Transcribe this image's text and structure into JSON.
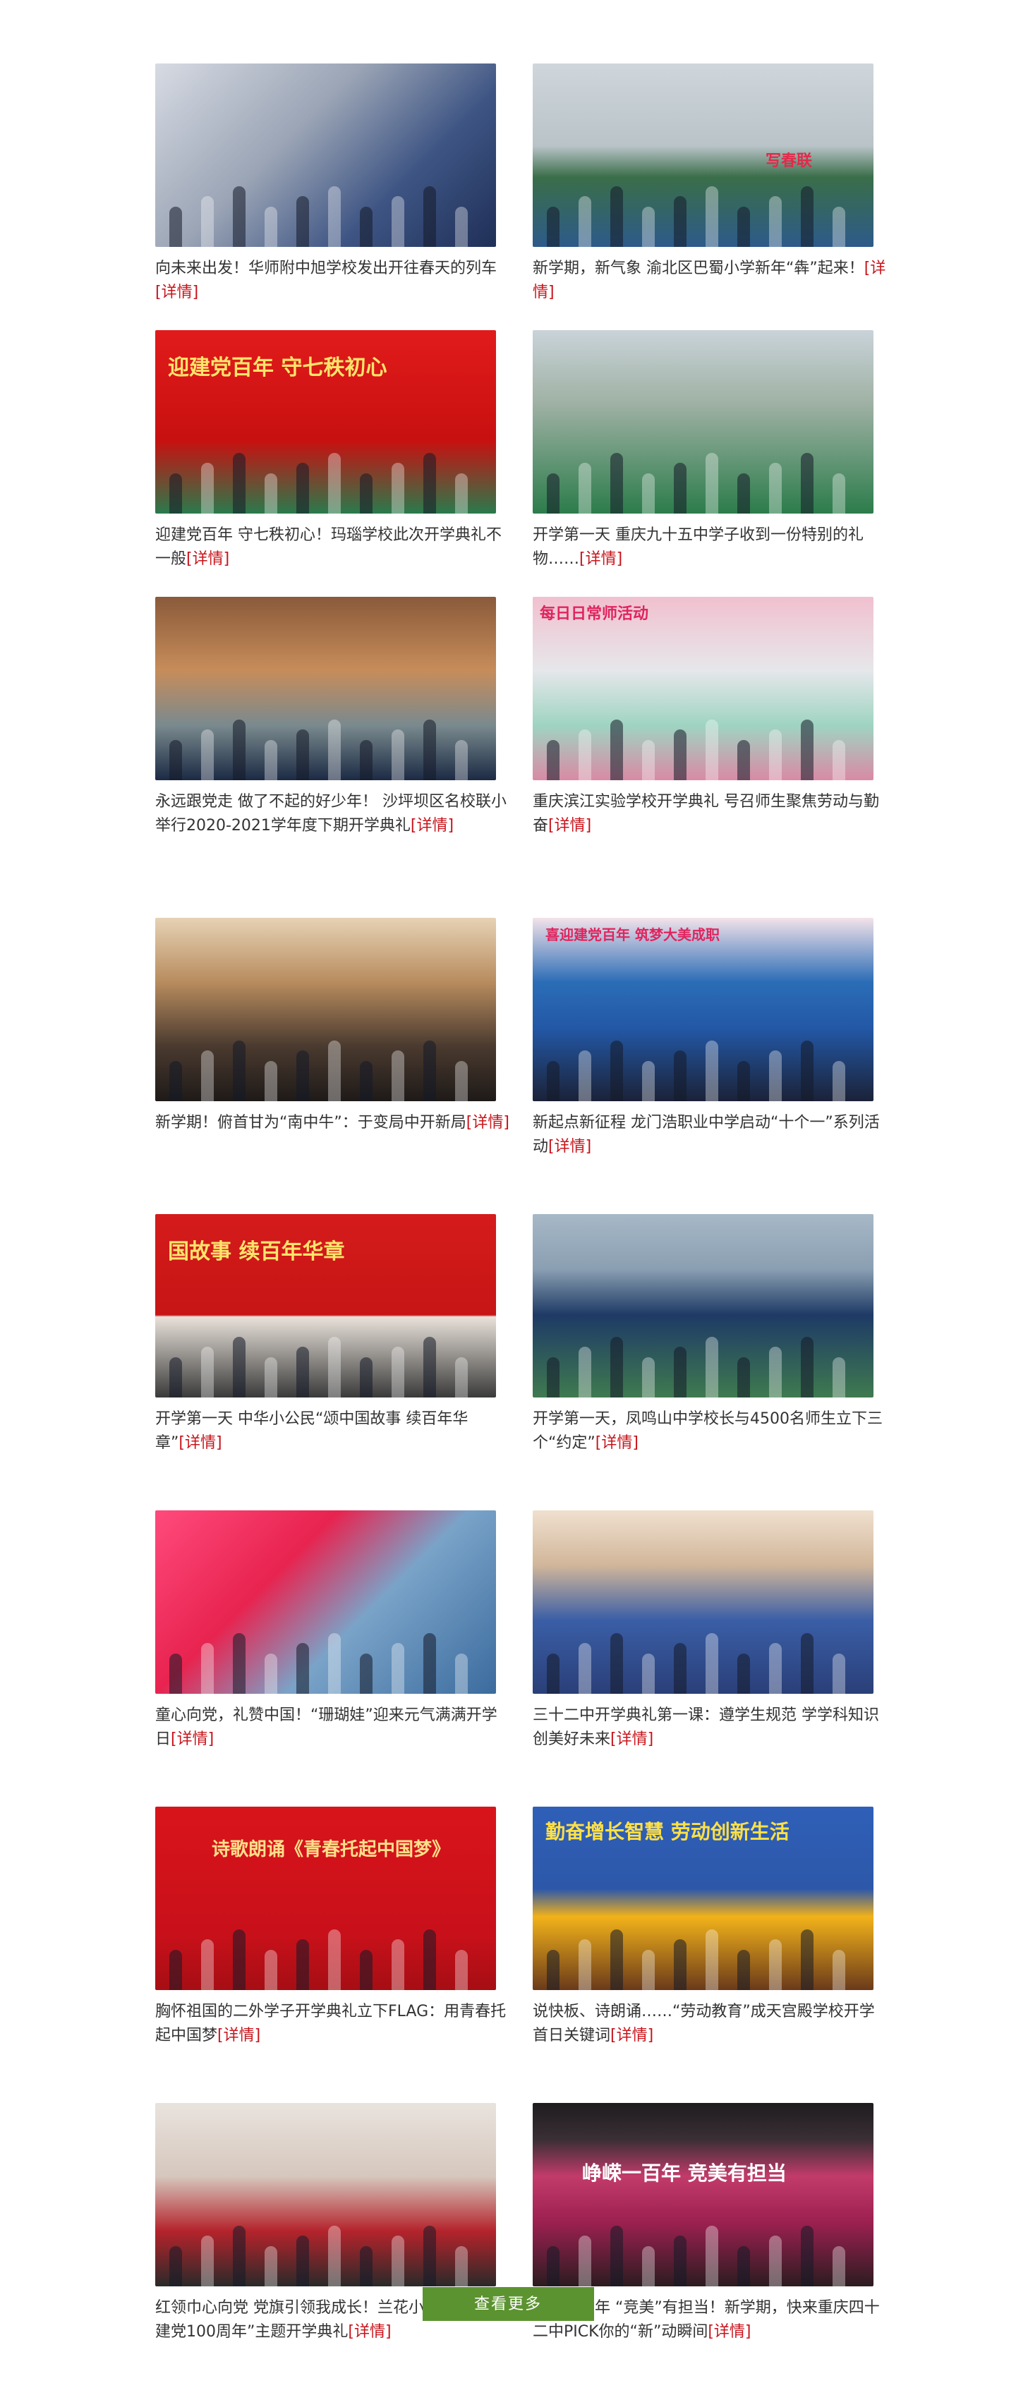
{
  "more_label": "[详情]",
  "load_more": "查看更多",
  "accent": "#c8141b",
  "button_color": "#5c9331",
  "items": [
    {
      "caption": "向未来出发！华师附中旭学校发出开往春天的列车",
      "bg": "linear-gradient(135deg,#d7dbe3 0%,#9aa4b5 40%,#3e5584 70%,#1f2f57 100%)",
      "overlay": ""
    },
    {
      "caption": "新学期，新气象 渝北区巴蜀小学新年“犇”起来！",
      "bg": "linear-gradient(180deg,#cfd6dc 0%,#b9c3c8 45%,#3a6e49 62%,#2d5a8a 100%)",
      "overlay": "写春联"
    },
    {
      "caption": "迎建党百年 守七秩初心！玛瑙学校此次开学典礼不一般",
      "bg": "linear-gradient(180deg,#e11b1b 0%,#c81010 60%,#2a7a4c 100%)",
      "overlay": "迎建党百年  守七秩初心"
    },
    {
      "caption": "开学第一天 重庆九十五中学子收到一份特别的礼物……",
      "bg": "linear-gradient(180deg,#c9d3d9 0%,#9fb1a4 40%,#2c7c4b 100%)",
      "overlay": ""
    },
    {
      "caption": "永远跟党走 做了不起的好少年！ 沙坪坝区名校联小举行2020-2021学年度下期开学典礼",
      "bg": "linear-gradient(180deg,#8a5a3a 0%,#c78c5a 40%,#7a8a8e 70%,#1c2a44 100%)",
      "overlay": ""
    },
    {
      "caption": "重庆滨江实验学校开学典礼 号召师生聚焦劳动与勤奋",
      "bg": "linear-gradient(180deg,#f1c0cf 0%,#e6e7ea 40%,#9fd4c2 70%,#d98aa4 100%)",
      "overlay": "每日日常师活动"
    },
    {
      "caption": "新学期！俯首甘为“南中牛”：于变局中开新局",
      "bg": "linear-gradient(180deg,#e6d2b5 0%,#b88c5e 35%,#4a3a2f 70%,#1e1a18 100%)",
      "overlay": ""
    },
    {
      "caption": "新起点新征程 龙门浩职业中学启动“十个一”系列活动",
      "bg": "linear-gradient(180deg,#f3e3e9 0%,#2b6db6 35%,#2358a6 60%,#1b2238 100%)",
      "overlay": "喜迎建党百年  筑梦大美成职"
    },
    {
      "caption": "开学第一天 中华小公民“颂中国故事 续百年华章”",
      "bg": "linear-gradient(180deg,#d51b1b 0%,#c71515 55%,#e9e2da 56%,#3a3a3a 100%)",
      "overlay": "国故事 续百年华章"
    },
    {
      "caption": "开学第一天，凤鸣山中学校长与4500名师生立下三个“约定”",
      "bg": "linear-gradient(180deg,#a7b8c7 0%,#8a9fb2 30%,#1e3a66 55%,#3f7a4f 100%)",
      "overlay": ""
    },
    {
      "caption": "童心向党，礼赞中国！“珊瑚娃”迎来元气满满开学日",
      "bg": "linear-gradient(135deg,#ff4a7c 0%,#e8234f 35%,#7aa3c8 60%,#3b6b9e 100%)",
      "overlay": ""
    },
    {
      "caption": "三十二中开学典礼第一课：遵学生规范 学学科知识 创美好未来",
      "bg": "linear-gradient(180deg,#f0e0cf 0%,#d1b69a 30%,#3a5ea6 60%,#2a3f78 100%)",
      "overlay": ""
    },
    {
      "caption": "胸怀祖国的二外学子开学典礼立下FLAG：用青春托起中国梦",
      "bg": "linear-gradient(180deg,#d9141b 0%,#c8101a 70%,#a60e14 100%)",
      "overlay": "诗歌朗诵《青春托起中国梦》"
    },
    {
      "caption": "说快板、诗朗诵……“劳动教育”成天宫殿学校开学首日关键词",
      "bg": "linear-gradient(180deg,#2f5fb8 0%,#2d58a9 45%,#f2b21a 60%,#6a3a1a 100%)",
      "overlay": "勤奋增长智慧  劳动创新生活"
    },
    {
      "caption": "红领巾心向党 党旗引领我成长！兰花小学举行“喜迎建党100周年”主题开学典礼",
      "bg": "linear-gradient(180deg,#e9e3de 0%,#d6c7bd 40%,#b4232b 70%,#2a2a2a 100%)",
      "overlay": ""
    },
    {
      "caption": "峥嵘一百年 “竞美”有担当！新学期，快来重庆四十二中PICK你的“新”动瞬间",
      "bg": "linear-gradient(180deg,#1e1c1e 0%,#3a2f35 20%,#c23b6a 40%,#9c2050 65%,#2b1c20 100%)",
      "overlay": "峥嵘一百年  竞美有担当"
    }
  ]
}
